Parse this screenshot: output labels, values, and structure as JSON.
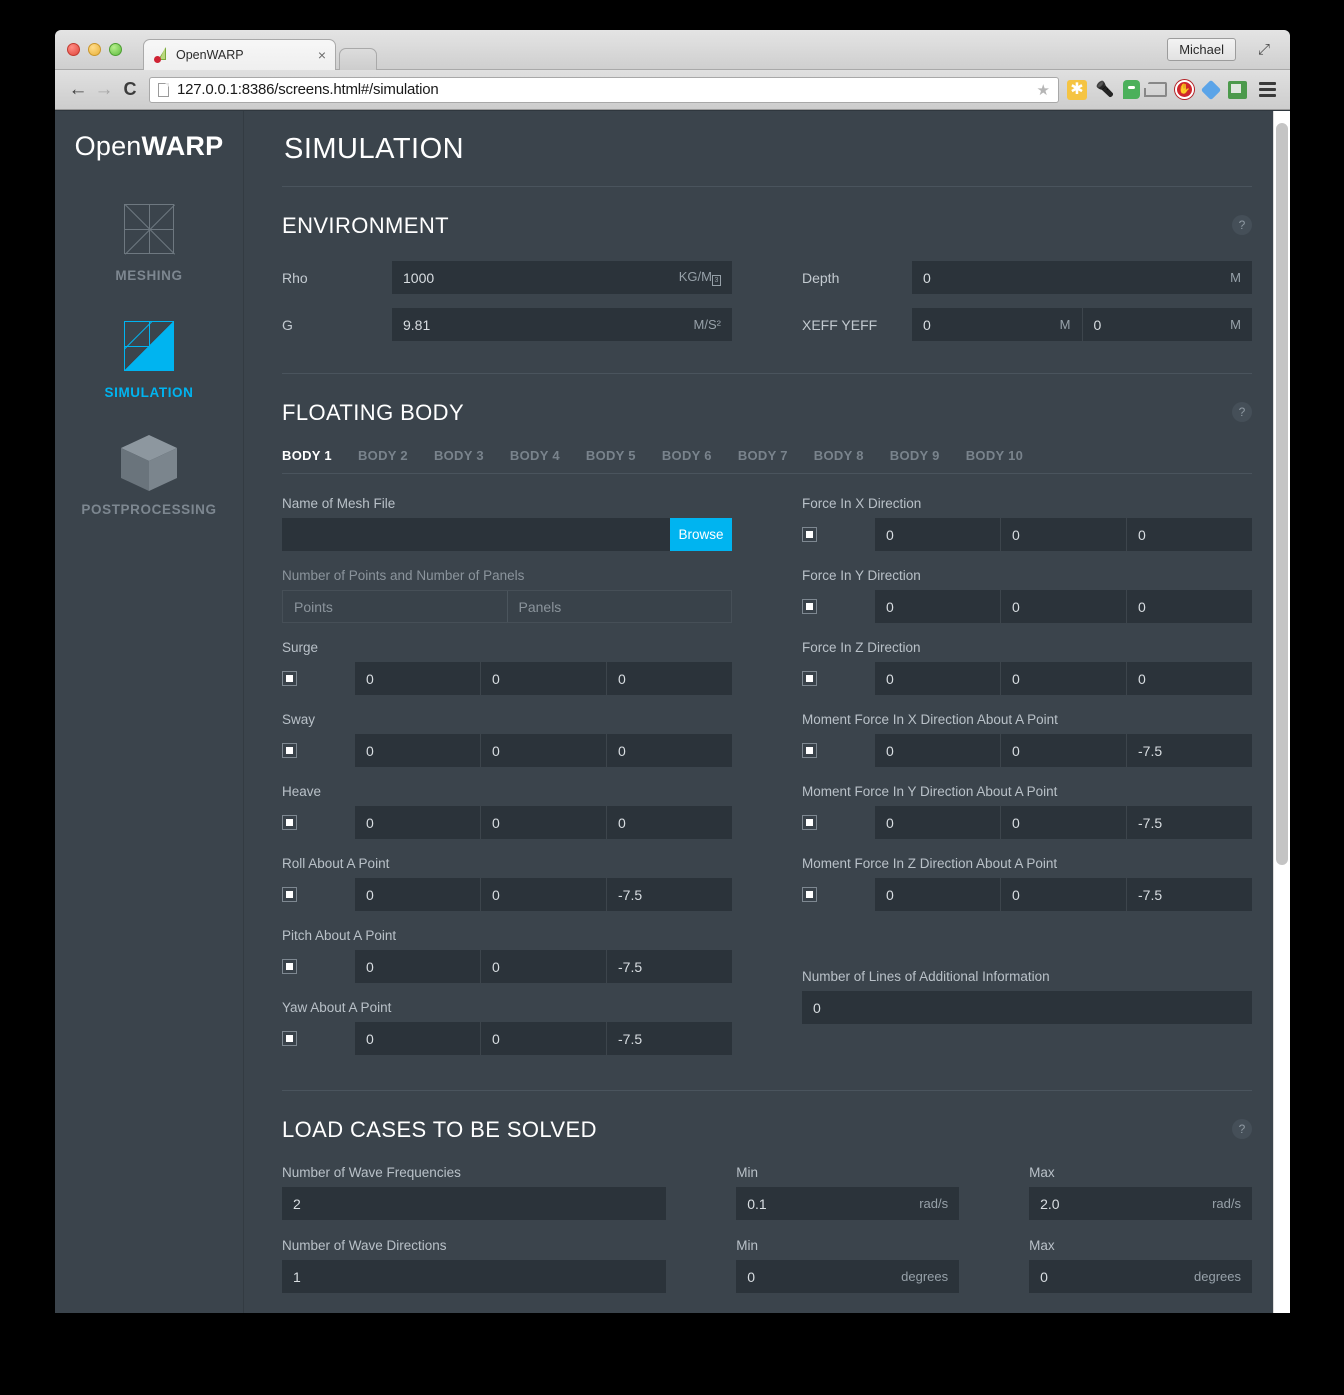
{
  "browser": {
    "tab_title": "OpenWARP",
    "tab_close": "×",
    "url": "127.0.0.1:8386/screens.html#/simulation",
    "profile_label": "Michael",
    "back_icon": "←",
    "forward_icon": "→",
    "reload_icon": "C",
    "star_icon": "★"
  },
  "sidebar": {
    "brand_prefix": "Open",
    "brand_suffix": "WARP",
    "items": [
      {
        "label": "MESHING",
        "icon": "mesh-icon",
        "active": false
      },
      {
        "label": "SIMULATION",
        "icon": "simulation-icon",
        "active": true
      },
      {
        "label": "POSTPROCESSING",
        "icon": "cube-icon",
        "active": false
      }
    ]
  },
  "page": {
    "title": "SIMULATION"
  },
  "environment": {
    "title": "ENVIRONMENT",
    "help": "?",
    "rho": {
      "label": "Rho",
      "value": "1000",
      "unit": "KG/M",
      "unit_tofu": "3"
    },
    "g": {
      "label": "G",
      "value": "9.81",
      "unit": "M/S²"
    },
    "depth": {
      "label": "Depth",
      "value": "0",
      "unit": "M"
    },
    "xeff_yeff": {
      "label": "XEFF YEFF",
      "x_value": "0",
      "x_unit": "M",
      "y_value": "0",
      "y_unit": "M"
    }
  },
  "floating_body": {
    "title": "FLOATING BODY",
    "help": "?",
    "tabs": [
      {
        "label": "BODY 1",
        "active": true
      },
      {
        "label": "BODY 2",
        "active": false
      },
      {
        "label": "BODY 3",
        "active": false
      },
      {
        "label": "BODY 4",
        "active": false
      },
      {
        "label": "BODY 5",
        "active": false
      },
      {
        "label": "BODY 6",
        "active": false
      },
      {
        "label": "BODY 7",
        "active": false
      },
      {
        "label": "BODY 8",
        "active": false
      },
      {
        "label": "BODY 9",
        "active": false
      },
      {
        "label": "BODY 10",
        "active": false
      }
    ],
    "mesh_file": {
      "label": "Name of Mesh File",
      "value": "",
      "placeholder": "",
      "browse_label": "Browse"
    },
    "points_panels": {
      "label": "Number of Points and Number of Panels",
      "points_placeholder": "Points",
      "panels_placeholder": "Panels"
    },
    "left_rows": [
      {
        "label": "Surge",
        "checked": true,
        "v1": "0",
        "v2": "0",
        "v3": "0"
      },
      {
        "label": "Sway",
        "checked": true,
        "v1": "0",
        "v2": "0",
        "v3": "0"
      },
      {
        "label": "Heave",
        "checked": true,
        "v1": "0",
        "v2": "0",
        "v3": "0"
      },
      {
        "label": "Roll About A Point",
        "checked": true,
        "v1": "0",
        "v2": "0",
        "v3": "-7.5"
      },
      {
        "label": "Pitch About A Point",
        "checked": true,
        "v1": "0",
        "v2": "0",
        "v3": "-7.5"
      },
      {
        "label": "Yaw About A Point",
        "checked": true,
        "v1": "0",
        "v2": "0",
        "v3": "-7.5"
      }
    ],
    "right_rows": [
      {
        "label": "Force In X Direction",
        "checked": true,
        "v1": "0",
        "v2": "0",
        "v3": "0"
      },
      {
        "label": "Force In Y Direction",
        "checked": true,
        "v1": "0",
        "v2": "0",
        "v3": "0"
      },
      {
        "label": "Force In Z Direction",
        "checked": true,
        "v1": "0",
        "v2": "0",
        "v3": "0"
      },
      {
        "label": "Moment Force In X Direction About A Point",
        "checked": true,
        "v1": "0",
        "v2": "0",
        "v3": "-7.5"
      },
      {
        "label": "Moment Force In Y Direction About A Point",
        "checked": true,
        "v1": "0",
        "v2": "0",
        "v3": "-7.5"
      },
      {
        "label": "Moment Force In Z Direction About A Point",
        "checked": true,
        "v1": "0",
        "v2": "0",
        "v3": "-7.5"
      }
    ],
    "additional_info": {
      "label": "Number of Lines of Additional Information",
      "value": "0"
    }
  },
  "load_cases": {
    "title": "LOAD CASES TO BE SOLVED",
    "help": "?",
    "frequencies": {
      "count_label": "Number of Wave Frequencies",
      "count_value": "2",
      "min_label": "Min",
      "min_value": "0.1",
      "min_unit": "rad/s",
      "max_label": "Max",
      "max_value": "2.0",
      "max_unit": "rad/s"
    },
    "directions": {
      "count_label": "Number of Wave Directions",
      "count_value": "1",
      "min_label": "Min",
      "min_value": "0",
      "min_unit": "degrees",
      "max_label": "Max",
      "max_value": "0",
      "max_unit": "degrees"
    }
  },
  "colors": {
    "accent": "#00b4f0",
    "app_bg": "#3b444c",
    "field_bg": "#2b333a",
    "text_primary": "#ffffff",
    "text_muted": "#8b949c"
  }
}
